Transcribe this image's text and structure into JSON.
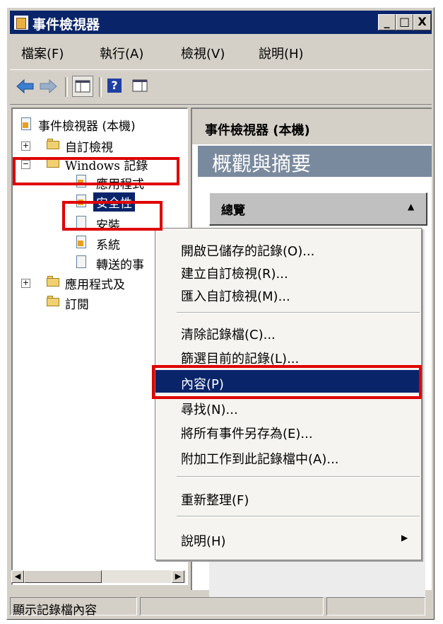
{
  "window": {
    "title": "事件檢視器",
    "minimize": "_",
    "maximize": "□",
    "close": "X"
  },
  "menu": [
    "檔案(F)",
    "執行(A)",
    "檢視(V)",
    "說明(H)"
  ],
  "toolbar": {
    "back_icon": "arrow-left-icon",
    "forward_icon": "arrow-right-icon",
    "help_label": "?"
  },
  "tree": {
    "root": "事件檢視器 (本機)",
    "custom_views": "自訂檢視",
    "windows_logs": "Windows 記錄",
    "application": "應用程式",
    "security": "安全性",
    "setup": "安裝",
    "system": "系統",
    "forwarded": "轉送的事",
    "apps_services": "應用程式及",
    "subscriptions": "訂閱"
  },
  "right_pane": {
    "header": "事件檢視器 (本機)",
    "band_title": "概觀與摘要",
    "overview_label": "總覽"
  },
  "context_menu": {
    "items": [
      "開啟已儲存的記錄(O)...",
      "建立自訂檢視(R)...",
      "匯入自訂檢視(M)...",
      "清除記錄檔(C)...",
      "篩選目前的記錄(L)...",
      "內容(P)",
      "尋找(N)...",
      "將所有事件另存為(E)...",
      "附加工作到此記錄檔中(A)...",
      "重新整理(F)",
      "說明(H)"
    ],
    "highlighted_index": 5
  },
  "status": {
    "text": "顯示記錄檔內容"
  },
  "colors": {
    "titlebar": "#0a246a",
    "highlight": "#0a246a",
    "annotation": "#e00000"
  }
}
